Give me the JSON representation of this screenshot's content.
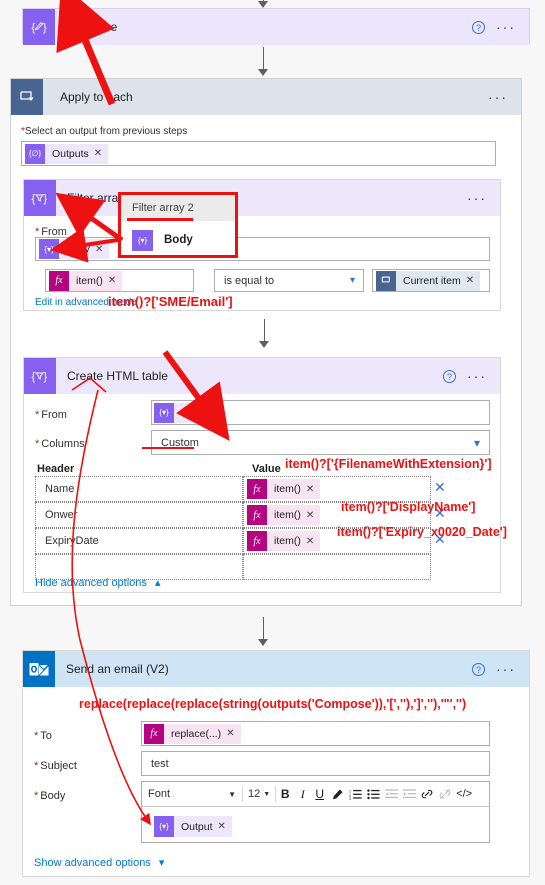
{
  "flow": {
    "steps": [
      {
        "id": "compose",
        "title": "Compose",
        "icon": "compose-braces-icon",
        "help_label": "?",
        "menu_label": "···"
      },
      {
        "id": "apply-to-each",
        "title": "Apply to each",
        "icon": "loop-icon",
        "menu_label": "···",
        "select_output_label": "Select an output from previous steps",
        "select_output_token": "Outputs"
      },
      {
        "id": "filter-array",
        "title": "Filter array",
        "icon": "filter-braces-icon",
        "menu_label": "···",
        "from_label": "From",
        "from_token": "Body",
        "condition_left_token": "item()",
        "condition_operator": "is equal to",
        "condition_right_token": "Current item",
        "advanced_link": "Edit in advanced mode"
      },
      {
        "id": "create-html-table",
        "title": "Create HTML table",
        "icon": "filter-braces-icon",
        "help_label": "?",
        "menu_label": "···",
        "from_label": "From",
        "from_token": "Body",
        "columns_label": "Columns",
        "columns_value": "Custom",
        "header_col_label": "Header",
        "value_col_label": "Value",
        "rows": [
          {
            "header": "Name",
            "value_token": "item()"
          },
          {
            "header": "Onwer",
            "value_token": "item()"
          },
          {
            "header": "ExpiryDate",
            "value_token": "item()"
          },
          {
            "header": "",
            "value_token": ""
          }
        ],
        "advanced_link": "Hide advanced options"
      },
      {
        "id": "send-an-email",
        "title": "Send an email (V2)",
        "icon": "outlook-icon",
        "help_label": "?",
        "menu_label": "···",
        "to_label": "To",
        "to_token": "replace(...)",
        "subject_label": "Subject",
        "subject_value": "test",
        "body_label": "Body",
        "body_token": "Output",
        "advanced_link": "Show advanced options",
        "toolbar": {
          "font_name": "Font",
          "font_size": "12",
          "bold": "B",
          "italic": "I",
          "underline": "U",
          "highlight": "highlighter-icon",
          "numbered_list": "numbered-list-icon",
          "bulleted_list": "bulleted-list-icon",
          "indent": "indent-icon",
          "outdent": "outdent-icon",
          "link": "link-icon",
          "unlink": "unlink-icon",
          "code": "</>"
        }
      }
    ]
  },
  "popup": {
    "title": "Filter array 2",
    "item_label": "Body",
    "item_icon": "filter-braces-icon"
  },
  "annotations": [
    {
      "id": "sme-email",
      "text": "item()?['SME/Email']"
    },
    {
      "id": "filename",
      "text": "item()?['{FilenameWithExtension}']"
    },
    {
      "id": "displayname",
      "text": "item()?['DisplayName']"
    },
    {
      "id": "expirydate",
      "text": "item()?['Expiry_x0020_Date']"
    },
    {
      "id": "replace-expression",
      "text": "replace(replace(replace(string(outputs('Compose')),'[',''),']',''),'\"','')"
    }
  ],
  "colors": {
    "annotation_red": "#ee1111",
    "purple_icon": "#8661ef",
    "loop_icon": "#486591",
    "outlook_icon": "#0072c6",
    "header_purple": "#ece7fb",
    "header_blue": "#cfe4f5",
    "link_blue": "#0078d4",
    "required_red": "#a4262c"
  }
}
